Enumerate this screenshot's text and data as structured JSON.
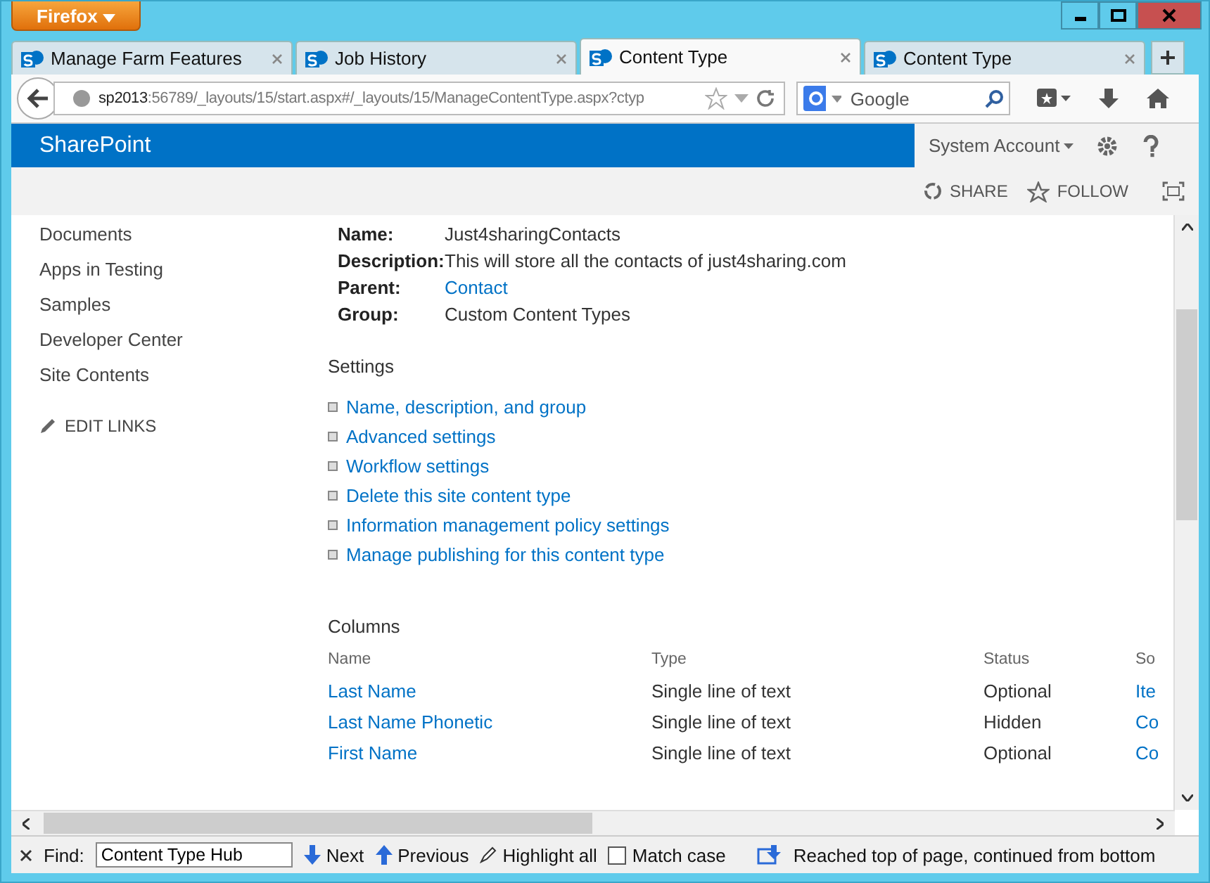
{
  "browser": {
    "menu_button": "Firefox",
    "tabs": [
      {
        "title": "Manage Farm Features",
        "selected": false
      },
      {
        "title": "Job History",
        "selected": false
      },
      {
        "title": "Content Type",
        "selected": true
      },
      {
        "title": "Content Type",
        "selected": false
      }
    ],
    "url_host": "sp2013",
    "url_rest": ":56789/_layouts/15/start.aspx#/_layouts/15/ManageContentType.aspx?ctyp",
    "search_placeholder": "Google"
  },
  "sharepoint": {
    "brand": "SharePoint",
    "account": "System Account",
    "actions": [
      "SHARE",
      "FOLLOW"
    ]
  },
  "sidebar": {
    "items": [
      "Documents",
      "Apps in Testing",
      "Samples",
      "Developer Center",
      "Site Contents"
    ],
    "edit_links": "EDIT LINKS"
  },
  "properties": [
    {
      "label": "Name:",
      "value": "Just4sharingContacts",
      "kind": "text"
    },
    {
      "label": "Description:",
      "value": "This will store all the contacts of just4sharing.com",
      "kind": "text"
    },
    {
      "label": "Parent:",
      "value": "Contact",
      "kind": "link"
    },
    {
      "label": "Group:",
      "value": "Custom Content Types",
      "kind": "text"
    }
  ],
  "settings": {
    "heading": "Settings",
    "links": [
      "Name, description, and group",
      "Advanced settings",
      "Workflow settings",
      "Delete this site content type",
      "Information management policy settings",
      "Manage publishing for this content type"
    ]
  },
  "columns": {
    "heading": "Columns",
    "headers": [
      "Name",
      "Type",
      "Status",
      "So"
    ],
    "rows": [
      {
        "cells": [
          "Last Name",
          "Single line of text",
          "Optional",
          "Ite"
        ]
      },
      {
        "cells": [
          "Last Name Phonetic",
          "Single line of text",
          "Hidden",
          "Co"
        ]
      },
      {
        "cells": [
          "First Name",
          "Single line of text",
          "Optional",
          "Co"
        ]
      }
    ]
  },
  "find_bar": {
    "label": "Find:",
    "value": "Content Type Hub",
    "next": "Next",
    "previous": "Previous",
    "highlight_all": "Highlight all",
    "match_case": {
      "label": "Match case",
      "checked": false
    },
    "status": "Reached top of page, continued from bottom"
  }
}
